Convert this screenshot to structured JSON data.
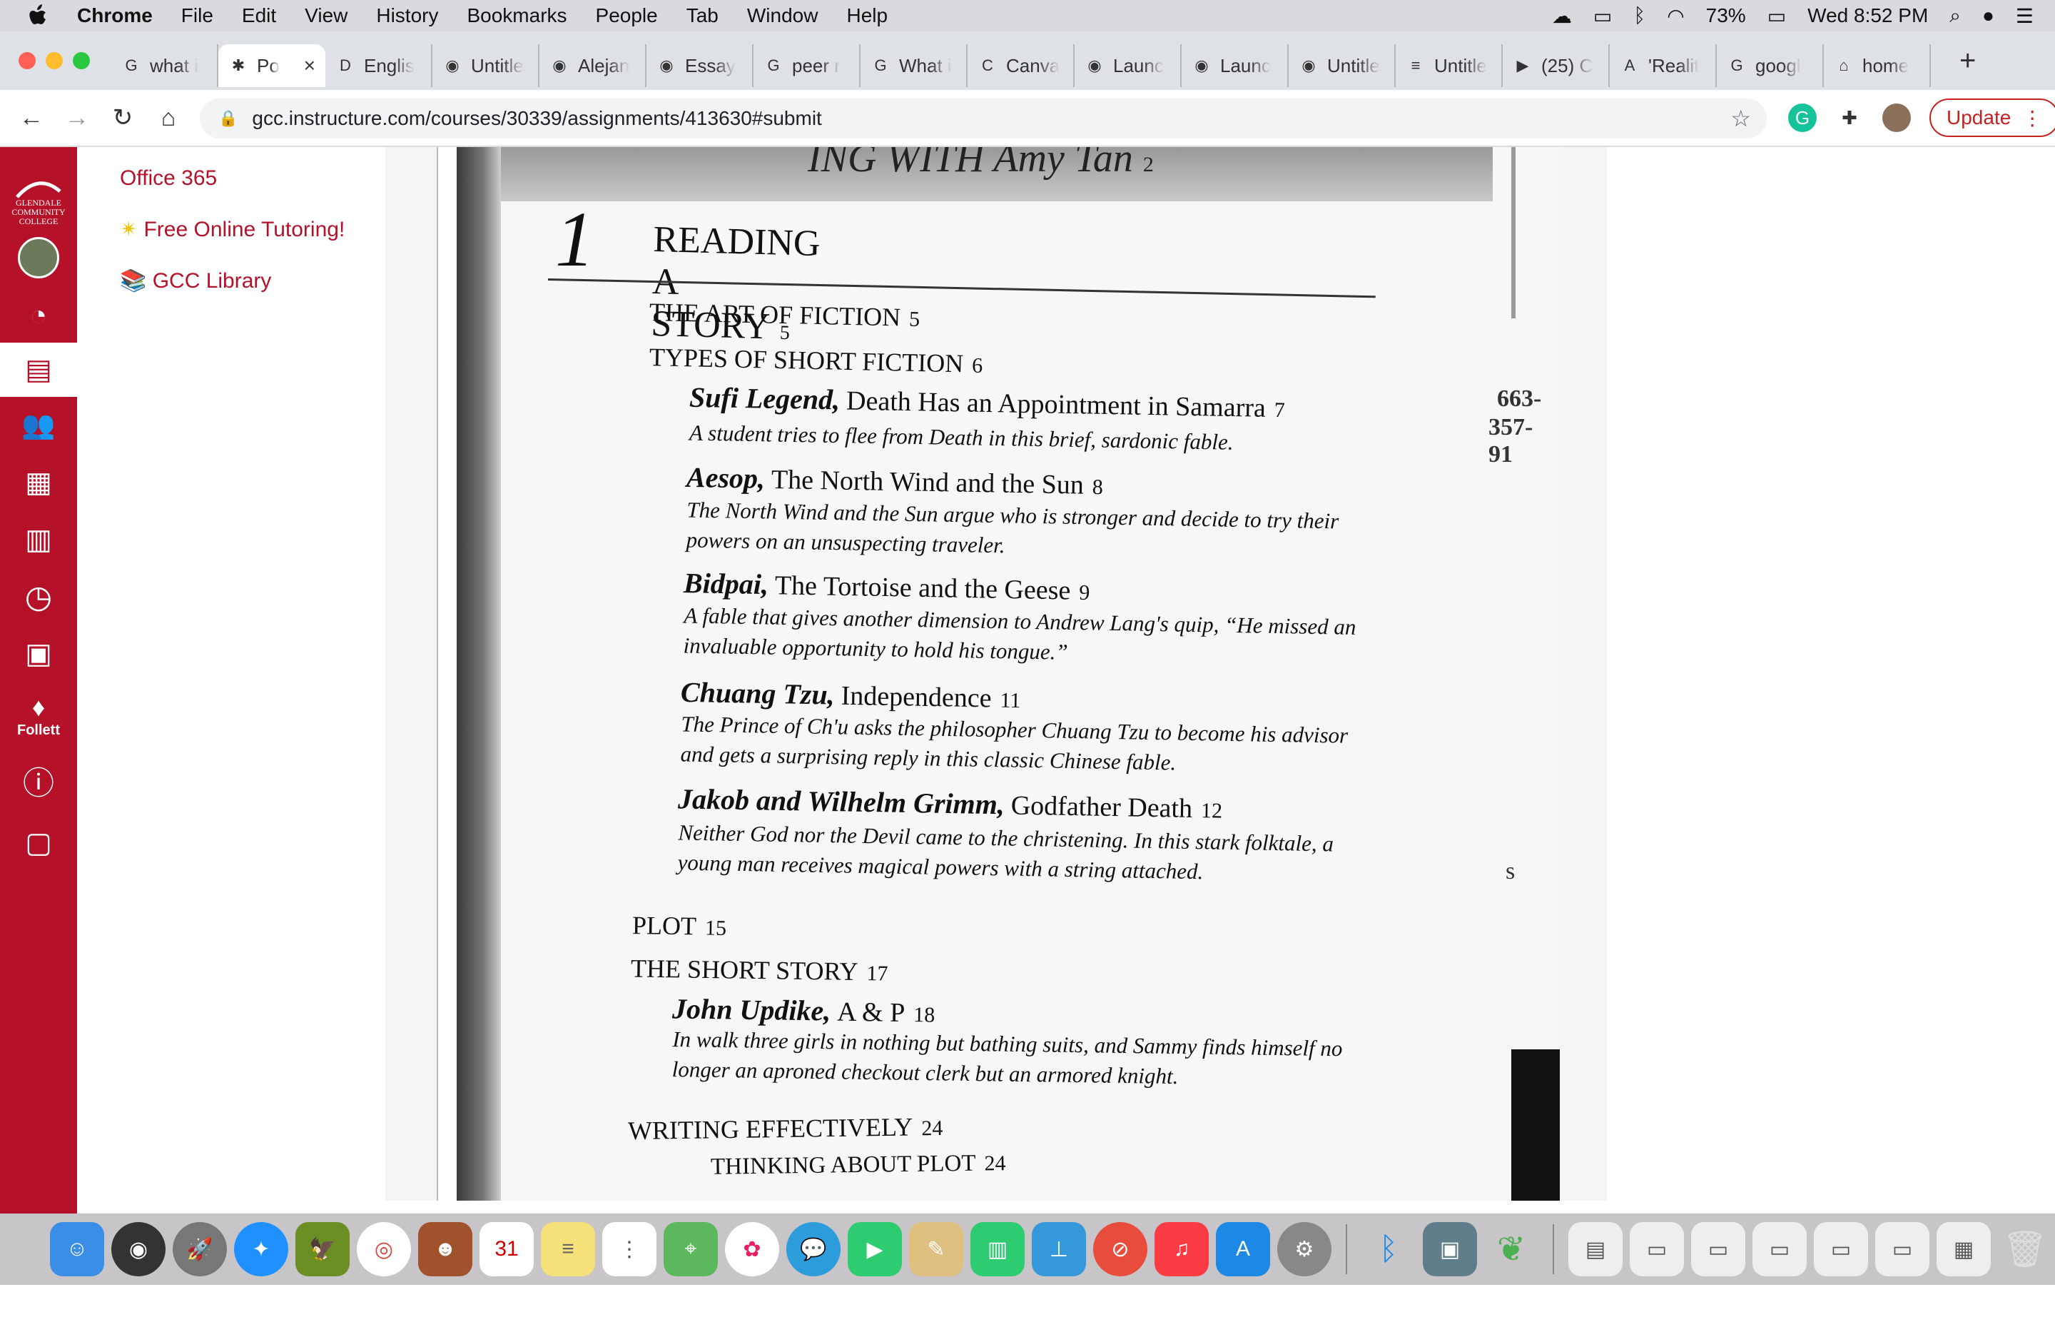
{
  "menubar": {
    "app": "Chrome",
    "items": [
      "File",
      "Edit",
      "View",
      "History",
      "Bookmarks",
      "People",
      "Tab",
      "Window",
      "Help"
    ],
    "battery": "73%",
    "clock": "Wed 8:52 PM"
  },
  "tabs": [
    {
      "icon": "G",
      "title": "what i",
      "active": false
    },
    {
      "icon": "✱",
      "title": "Po",
      "active": true
    },
    {
      "icon": "D",
      "title": "Englis",
      "active": false
    },
    {
      "icon": "◉",
      "title": "Untitle",
      "active": false
    },
    {
      "icon": "◉",
      "title": "Alejan",
      "active": false
    },
    {
      "icon": "◉",
      "title": "Essay",
      "active": false
    },
    {
      "icon": "G",
      "title": "peer r",
      "active": false
    },
    {
      "icon": "G",
      "title": "What i",
      "active": false
    },
    {
      "icon": "C",
      "title": "Canva",
      "active": false
    },
    {
      "icon": "◉",
      "title": "Launc",
      "active": false
    },
    {
      "icon": "◉",
      "title": "Launc",
      "active": false
    },
    {
      "icon": "◉",
      "title": "Untitle",
      "active": false
    },
    {
      "icon": "≡",
      "title": "Untitle",
      "active": false
    },
    {
      "icon": "▶",
      "title": "(25) C",
      "active": false
    },
    {
      "icon": "A",
      "title": "'Realit",
      "active": false
    },
    {
      "icon": "G",
      "title": "googl",
      "active": false
    },
    {
      "icon": "⌂",
      "title": "home",
      "active": false
    }
  ],
  "toolbar": {
    "url": "gcc.instructure.com/courses/30339/assignments/413630#submit",
    "update_label": "Update"
  },
  "canvas_nav": {
    "logo": "GLENDALE COMMUNITY COLLEGE",
    "follett": "Follett"
  },
  "secnav": {
    "office": "Office 365",
    "tutoring": "Free Online Tutoring!",
    "library": "GCC Library"
  },
  "scan": {
    "header": "ING WITH Amy Tan",
    "header_page": "2",
    "chapter_num": "1",
    "chapter_title": "READING A STORY",
    "chapter_page": "5",
    "sections": [
      {
        "title": "THE ART OF FICTION",
        "page": "5"
      },
      {
        "title": "TYPES OF SHORT FICTION",
        "page": "6"
      },
      {
        "title": "PLOT",
        "page": "15"
      },
      {
        "title": "THE SHORT STORY",
        "page": "17"
      },
      {
        "title": "WRITING EFFECTIVELY",
        "page": "24"
      },
      {
        "title": "THINKING ABOUT PLOT",
        "page": "24"
      }
    ],
    "entries": [
      {
        "author": "Sufi Legend,",
        "title": "Death Has an Appointment in Samarra",
        "page": "7",
        "desc": "A student tries to flee from Death in this brief, sardonic fable."
      },
      {
        "author": "Aesop,",
        "title": "The North Wind and the Sun",
        "page": "8",
        "desc": "The North Wind and the Sun argue who is stronger and decide to try their powers on an unsuspecting traveler."
      },
      {
        "author": "Bidpai,",
        "title": "The Tortoise and the Geese",
        "page": "9",
        "desc": "A fable that gives another dimension to Andrew Lang's quip, “He missed an invaluable opportunity to hold his tongue.”"
      },
      {
        "author": "Chuang Tzu,",
        "title": "Independence",
        "page": "11",
        "desc": "The Prince of Ch'u asks the philosopher Chuang Tzu to become his advisor and gets a surprising reply in this classic Chinese fable."
      },
      {
        "author": "Jakob and Wilhelm Grimm,",
        "title": "Godfather Death",
        "page": "12",
        "desc": "Neither God nor the Devil came to the christening. In this stark folktale, a young man receives magical powers with a string attached."
      },
      {
        "author": "John Updike,",
        "title": "A & P",
        "page": "18",
        "desc": "In walk three girls in nothing but bathing suits, and Sammy finds himself no longer an aproned checkout clerk but an armored knight."
      }
    ],
    "side": [
      "663-",
      "357-91",
      "s"
    ]
  },
  "colors": {
    "canvas_red": "#b5122a",
    "tabbar": "#dee1e6",
    "menubar": "#d9d9de"
  }
}
